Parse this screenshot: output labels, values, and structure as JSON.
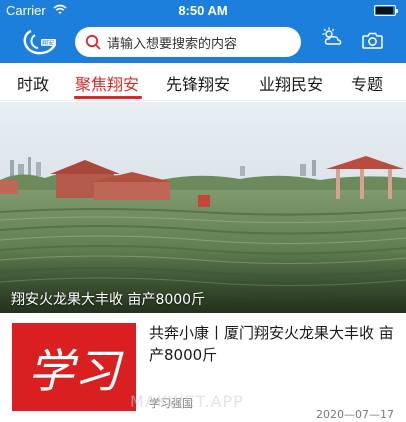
{
  "status_bar": {
    "carrier": "Carrier",
    "time": "8:50 AM",
    "wifi_icon": "wifi-icon",
    "battery_icon": "battery-icon"
  },
  "header": {
    "background_color": "#1c7fdc",
    "logo_icon": "app-logo-icon",
    "search_placeholder": "请输入想要搜索的内容",
    "search_icon": "search-icon",
    "weather_icon": "weather-icon",
    "camera_icon": "camera-icon"
  },
  "tabs": [
    {
      "label": "时政",
      "active": false
    },
    {
      "label": "聚焦翔安",
      "active": true
    },
    {
      "label": "先锋翔安",
      "active": false
    },
    {
      "label": "业翔民安",
      "active": false
    },
    {
      "label": "专题",
      "active": false
    }
  ],
  "tab_active_color": "#d62a2a",
  "hero": {
    "caption": "翔安火龙果大丰收 亩产8000斤"
  },
  "news": [
    {
      "thumbnail_text": "学习",
      "title": "共奔小康丨厦门翔安火龙果大丰收 亩产8000斤",
      "source": "学习强国",
      "date": "2020—07—17"
    }
  ],
  "watermark": "MAKWET.APP"
}
